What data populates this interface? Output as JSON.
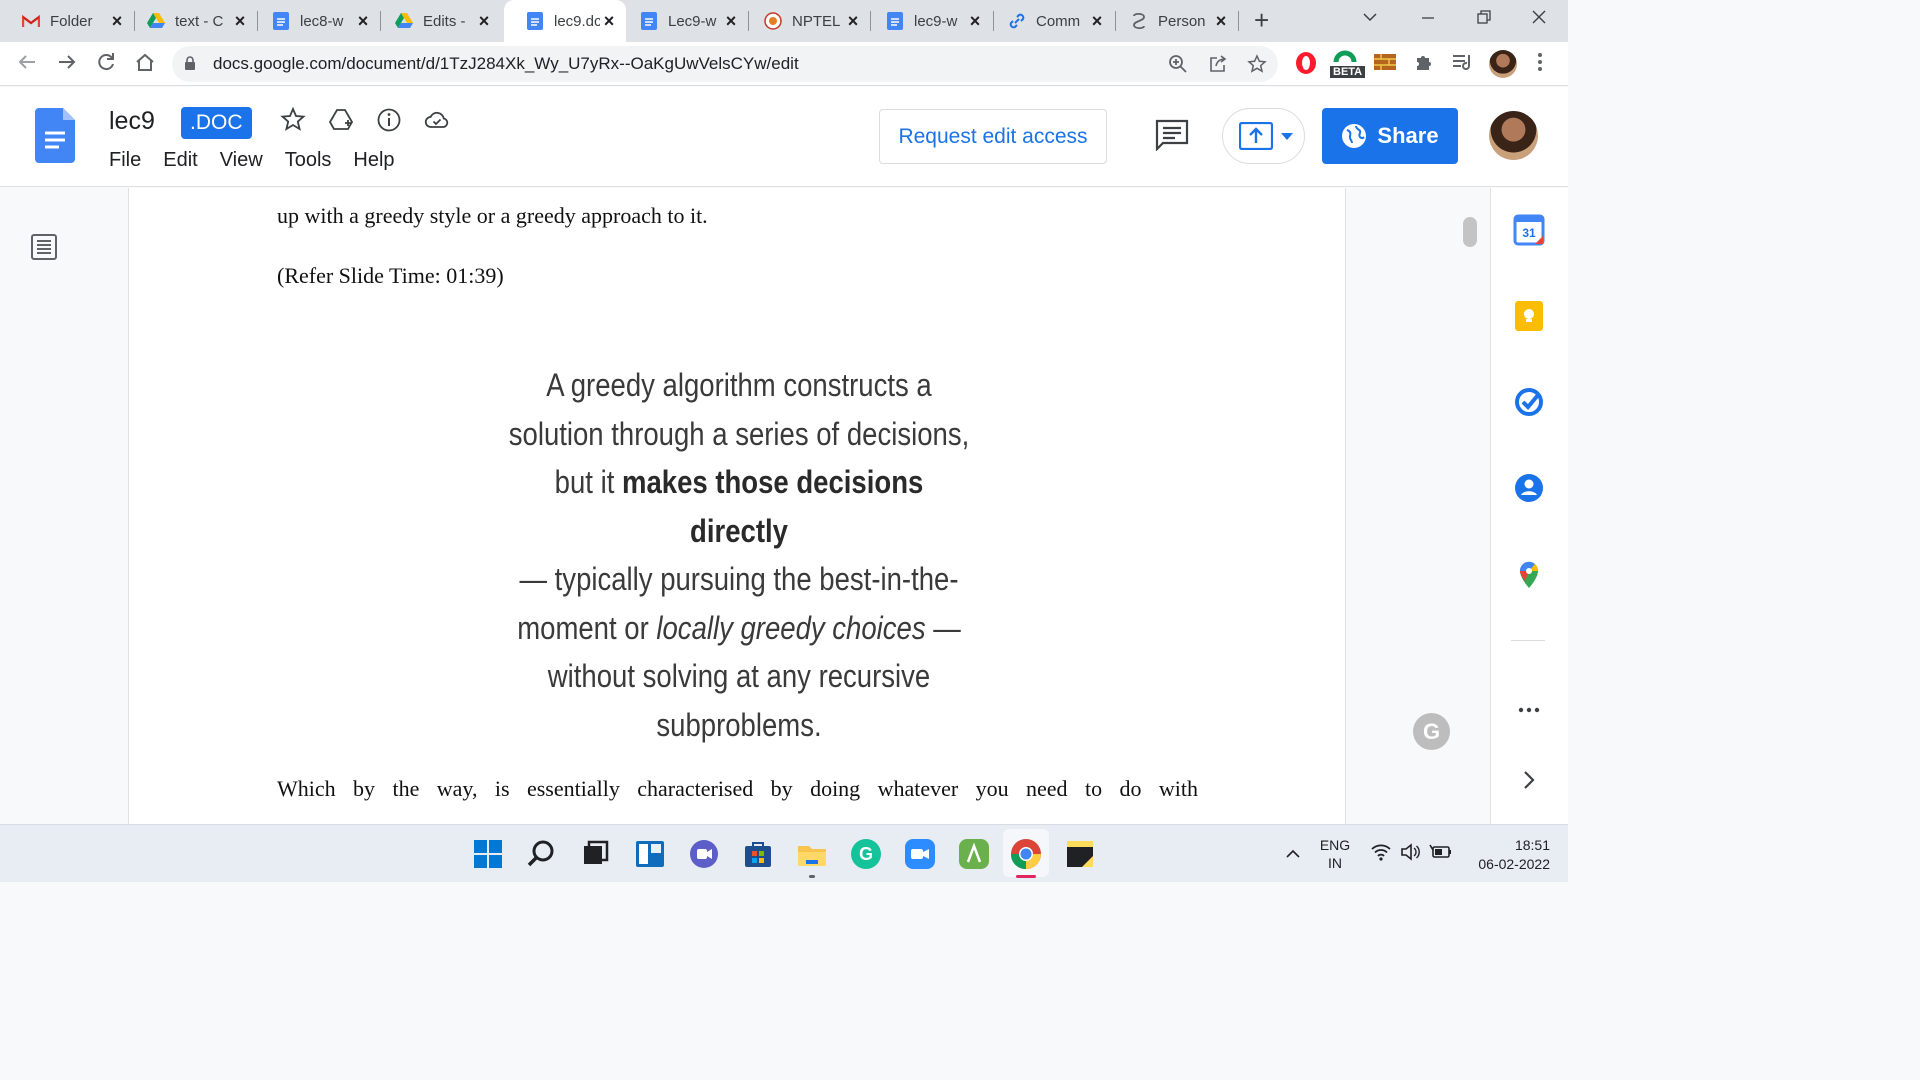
{
  "browser": {
    "tabs": [
      {
        "title": "Folder",
        "icon": "gmail-icon",
        "active": false
      },
      {
        "title": "text - C",
        "icon": "drive-icon",
        "active": false
      },
      {
        "title": "lec8-w",
        "icon": "docs-icon",
        "active": false
      },
      {
        "title": "Edits -",
        "icon": "drive-icon",
        "active": false
      },
      {
        "title": "lec9.dc",
        "icon": "docs-icon",
        "active": true
      },
      {
        "title": "Lec9-w",
        "icon": "docs-icon",
        "active": false
      },
      {
        "title": "NPTEL",
        "icon": "nptel-icon",
        "active": false
      },
      {
        "title": "lec9-w",
        "icon": "docs-icon",
        "active": false
      },
      {
        "title": "Comm",
        "icon": "link-icon",
        "active": false
      },
      {
        "title": "Person",
        "icon": "person-icon",
        "active": false
      }
    ],
    "url": "docs.google.com/document/d/1TzJ284Xk_Wy_U7yRx--OaKgUwVelsCYw/edit",
    "beta_label": "BETA"
  },
  "docs": {
    "title": "lec9",
    "badge": ".DOC",
    "menu": [
      "File",
      "Edit",
      "View",
      "Tools",
      "Help"
    ],
    "request_edit_label": "Request edit access",
    "share_label": "Share"
  },
  "document": {
    "line_top": "up with a greedy style or a greedy approach to it.",
    "refer_slide": "(Refer Slide Time: 01:39)",
    "quote": {
      "line1": "A greedy algorithm constructs a",
      "line2": "solution through a series of decisions,",
      "line3_pre": "but it ",
      "line3_bold": "makes those decisions directly",
      "line4": "— typically pursuing the best-in-the-",
      "line5_pre": "moment or ",
      "line5_italic": "locally greedy choices",
      "line5_post": " —",
      "line6": "without solving at any recursive",
      "line7": "subproblems."
    },
    "line_bottom": "Which by the way, is essentially characterised by doing whatever you need to do with"
  },
  "side_panel": [
    "calendar-icon",
    "keep-icon",
    "tasks-icon",
    "contacts-icon",
    "maps-icon"
  ],
  "side_calendar_day": "31",
  "taskbar": {
    "apps": [
      "windows-start-icon",
      "search-icon",
      "task-view-icon",
      "widgets-icon",
      "chat-icon",
      "store-icon",
      "file-explorer-icon",
      "grammarly-icon",
      "zoom-icon",
      "app-icon",
      "chrome-icon",
      "sticky-notes-icon"
    ],
    "lang_line1": "ENG",
    "lang_line2": "IN",
    "time": "18:51",
    "date": "06-02-2022"
  },
  "colors": {
    "accent": "#1a73e8",
    "tab_strip": "#dee1e6",
    "taskbar": "#e8ecf3"
  }
}
